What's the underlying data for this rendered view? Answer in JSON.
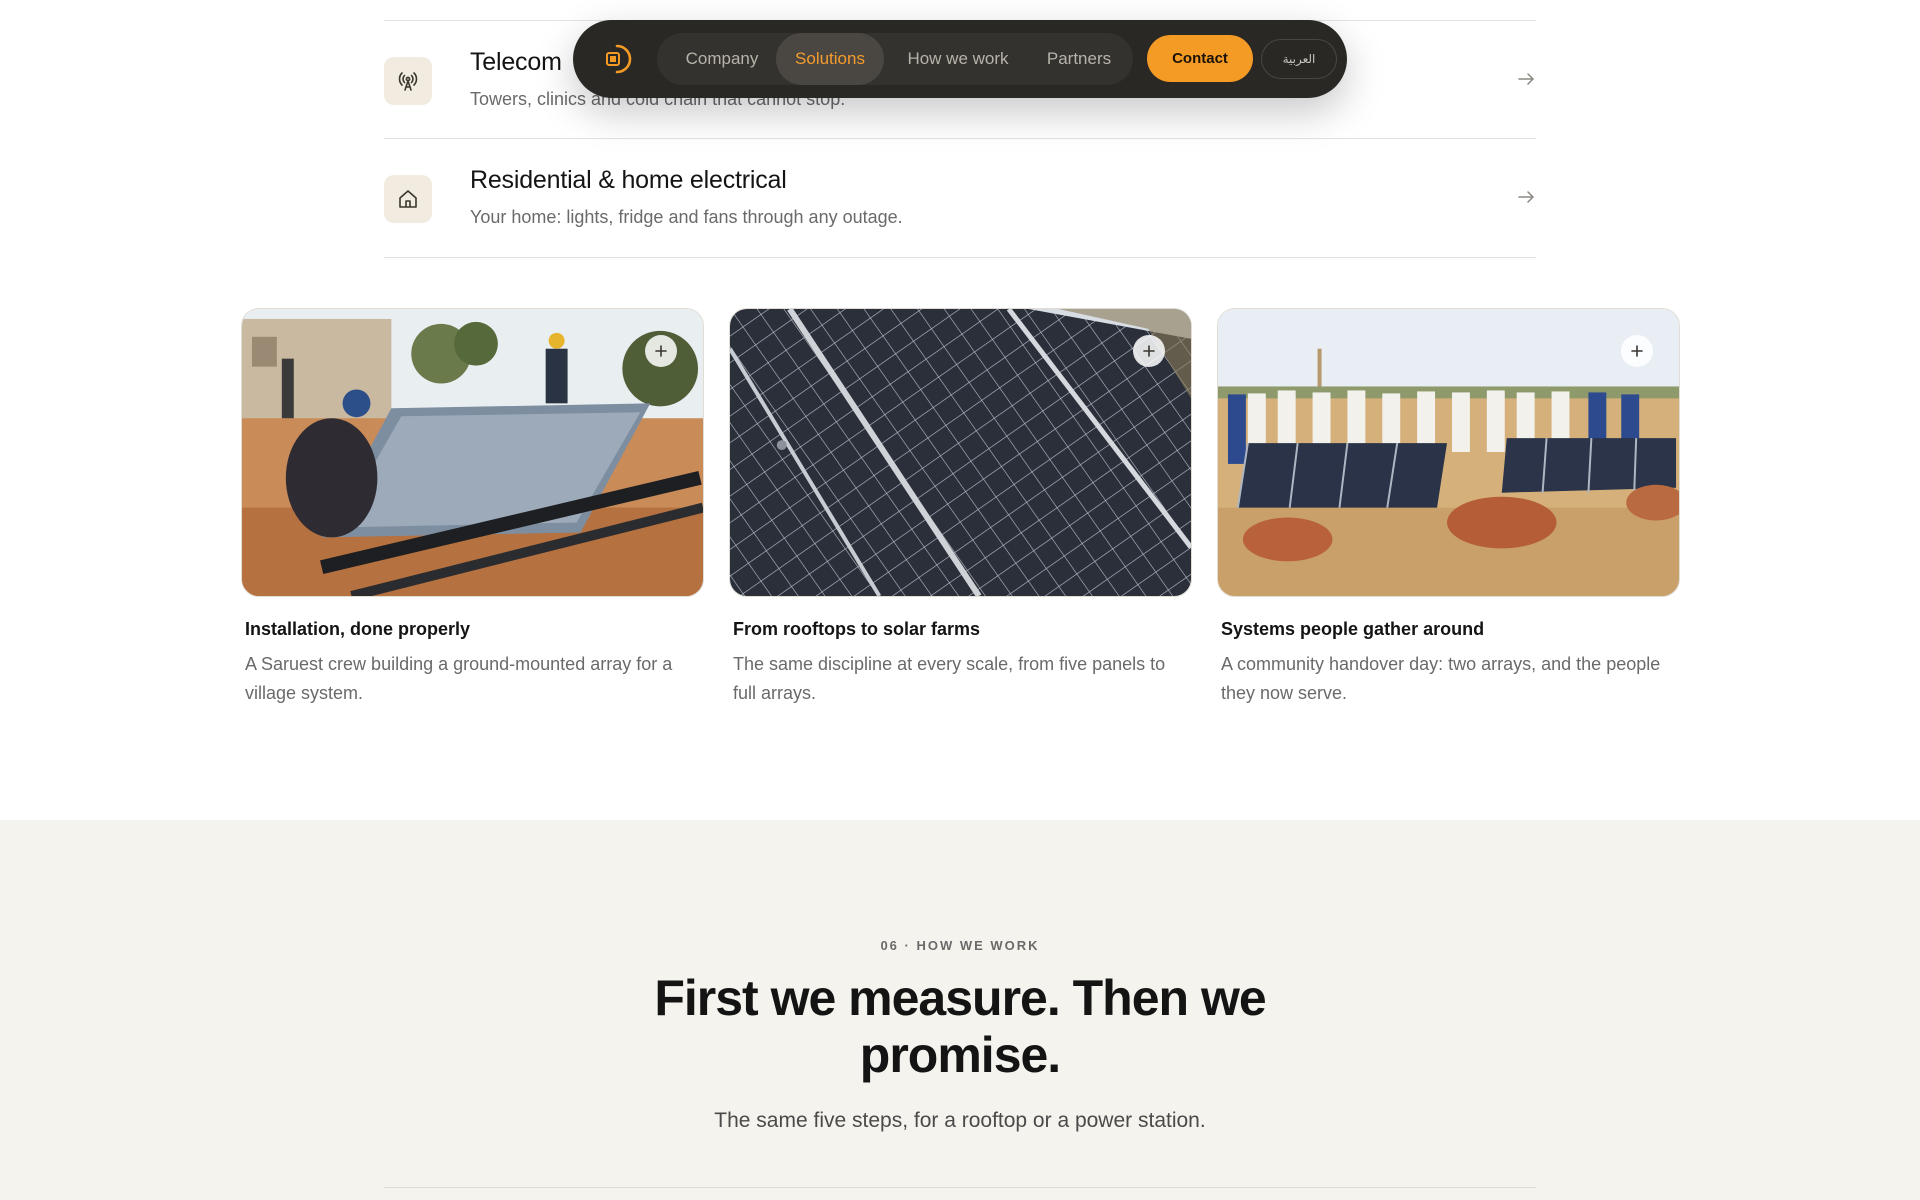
{
  "nav": {
    "links": [
      "Company",
      "Solutions",
      "How we work",
      "Partners"
    ],
    "active_link": "Solutions",
    "contact_label": "Contact",
    "language_label": "العربية",
    "accent_color": "#f49b25"
  },
  "solutions": [
    {
      "icon": "antenna-icon",
      "title": "Telecom",
      "description": "Towers, clinics and cold chain that cannot stop."
    },
    {
      "icon": "home-icon",
      "title": "Residential & home electrical",
      "description": "Your home: lights, fridge and fans through any outage."
    }
  ],
  "gallery": [
    {
      "title": "Installation, done properly",
      "description": "A Saruest crew building a ground-mounted array for a village system."
    },
    {
      "title": "From rooftops to solar farms",
      "description": "The same discipline at every scale, from five panels to full arrays."
    },
    {
      "title": "Systems people gather around",
      "description": "A community handover day: two arrays, and the people they now serve."
    }
  ],
  "how_we_work": {
    "eyebrow": "06 · HOW WE WORK",
    "headline": "First we measure. Then we promise.",
    "subline": "The same five steps, for a rooftop or a power station."
  }
}
